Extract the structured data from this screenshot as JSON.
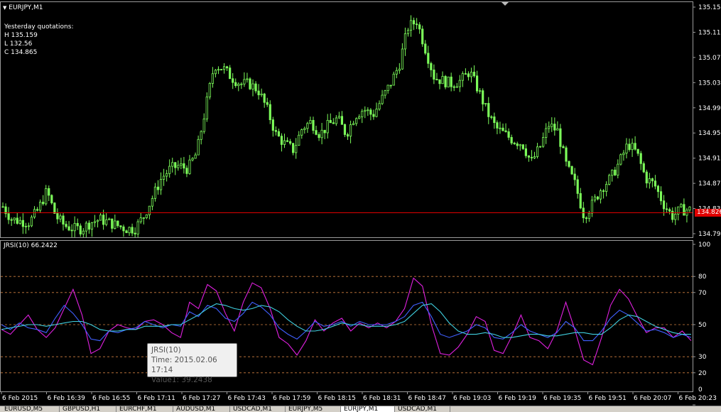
{
  "chart_header": {
    "symbol_label": "EURJPY,M1",
    "quotes_title": "Yesterday quotations:",
    "high": "H 135.159",
    "low": "L 132.56",
    "close": "C 134.865",
    "current_price": "134.826"
  },
  "indicator": {
    "label": "JRSI(10) 66.2422"
  },
  "tooltip": {
    "name": "JRSI(10)",
    "time": "Time: 2015.02.06 17:14",
    "value": "Value1: 39.2438"
  },
  "tabs": [
    {
      "label": "EURUSD,M5",
      "active": false
    },
    {
      "label": "GBPUSD,H1",
      "active": false
    },
    {
      "label": "EURCHF,M1",
      "active": false
    },
    {
      "label": "AUDUSD,M1",
      "active": false
    },
    {
      "label": "USDCAD,M1",
      "active": false
    },
    {
      "label": "EURJPY,M5",
      "active": false
    },
    {
      "label": "EURJPY,M1",
      "active": true
    },
    {
      "label": "USDCAD,M1",
      "active": false
    }
  ],
  "colors": {
    "background": "#000000",
    "candle": "#7cfc5a",
    "grid": "#808080",
    "price_line": "#e00000",
    "rsi_magenta": "#e020e0",
    "rsi_blue": "#4060ff",
    "rsi_cyan": "#40d0e0",
    "level_dashed": "#d08040"
  },
  "chart_data": [
    {
      "type": "candlestick",
      "title": "EURJPY,M1",
      "ylim": [
        134.792,
        135.152
      ],
      "y_ticks": [
        "135.152",
        "135.112",
        "135.072",
        "135.032",
        "134.992",
        "134.952",
        "134.912",
        "134.872",
        "134.832",
        "134.792"
      ],
      "x_ticks": [
        "6 Feb 2015",
        "6 Feb 16:39",
        "6 Feb 16:55",
        "6 Feb 17:11",
        "6 Feb 17:27",
        "6 Feb 17:43",
        "6 Feb 17:59",
        "6 Feb 18:15",
        "6 Feb 18:31",
        "6 Feb 18:47",
        "6 Feb 19:03",
        "6 Feb 19:19",
        "6 Feb 19:35",
        "6 Feb 19:51",
        "6 Feb 20:07",
        "6 Feb 20:23"
      ],
      "close_path": [
        134.835,
        134.815,
        134.812,
        134.81,
        134.83,
        134.86,
        134.82,
        134.805,
        134.8,
        134.8,
        134.81,
        134.815,
        134.81,
        134.805,
        134.8,
        134.8,
        134.82,
        134.85,
        134.88,
        134.895,
        134.9,
        134.895,
        134.92,
        134.99,
        135.06,
        135.055,
        135.04,
        135.03,
        135.03,
        135.02,
        134.99,
        134.95,
        134.935,
        134.925,
        134.96,
        134.97,
        134.95,
        134.965,
        134.975,
        134.95,
        134.98,
        134.99,
        134.98,
        135.005,
        135.03,
        135.06,
        135.12,
        135.13,
        135.085,
        135.04,
        135.035,
        135.03,
        135.035,
        135.05,
        135.02,
        134.985,
        134.96,
        134.95,
        134.94,
        134.935,
        134.905,
        134.93,
        134.965,
        134.955,
        134.9,
        134.87,
        134.82,
        134.84,
        134.865,
        134.88,
        134.905,
        134.935,
        134.92,
        134.88,
        134.87,
        134.84,
        134.82,
        134.83,
        134.83
      ],
      "current_price": 134.826
    },
    {
      "type": "line",
      "title": "JRSI(10) 66.2422",
      "ylim": [
        0,
        100
      ],
      "y_ticks": [
        "100",
        "80",
        "70",
        "50",
        "30",
        "20",
        "0"
      ],
      "levels": [
        80,
        70,
        50,
        30,
        20
      ],
      "series": [
        {
          "name": "",
          "color": "magenta",
          "values": [
            47,
            44,
            50,
            56,
            47,
            42,
            48,
            60,
            72,
            56,
            32,
            35,
            46,
            50,
            48,
            47,
            52,
            53,
            50,
            45,
            42,
            64,
            60,
            75,
            71,
            57,
            46,
            64,
            76,
            73,
            60,
            42,
            38,
            31,
            40,
            53,
            46,
            51,
            54,
            46,
            51,
            48,
            51,
            48,
            52,
            60,
            79,
            74,
            50,
            32,
            31,
            36,
            44,
            55,
            52,
            34,
            32,
            43,
            56,
            42,
            40,
            35,
            46,
            64,
            47,
            28,
            25,
            42,
            62,
            72,
            66,
            55,
            45,
            48,
            48,
            42,
            46,
            40
          ]
        },
        {
          "name": "",
          "color": "blue",
          "values": [
            50,
            47,
            51,
            48,
            47,
            45,
            54,
            62,
            57,
            50,
            41,
            40,
            46,
            45,
            47,
            48,
            52,
            50,
            48,
            50,
            49,
            58,
            55,
            62,
            60,
            54,
            52,
            57,
            64,
            61,
            56,
            48,
            44,
            41,
            46,
            52,
            49,
            50,
            52,
            49,
            52,
            50,
            50,
            50,
            52,
            55,
            62,
            64,
            55,
            44,
            42,
            44,
            46,
            50,
            48,
            42,
            41,
            45,
            50,
            46,
            44,
            42,
            45,
            52,
            48,
            40,
            40,
            46,
            54,
            59,
            56,
            51,
            46,
            47,
            45,
            42,
            44,
            42
          ]
        },
        {
          "name": "",
          "color": "cyan",
          "values": [
            47,
            48,
            49,
            50,
            50,
            49,
            50,
            51,
            52,
            52,
            50,
            47,
            46,
            46,
            47,
            47,
            49,
            49,
            49,
            50,
            50,
            53,
            56,
            60,
            63,
            62,
            60,
            59,
            60,
            62,
            61,
            58,
            53,
            49,
            46,
            46,
            47,
            49,
            51,
            50,
            50,
            49,
            49,
            49,
            50,
            52,
            57,
            62,
            63,
            58,
            51,
            46,
            44,
            44,
            45,
            44,
            42,
            42,
            43,
            44,
            44,
            43,
            43,
            44,
            45,
            45,
            44,
            44,
            48,
            53,
            56,
            55,
            52,
            49,
            47,
            45,
            44,
            44
          ]
        }
      ]
    }
  ]
}
